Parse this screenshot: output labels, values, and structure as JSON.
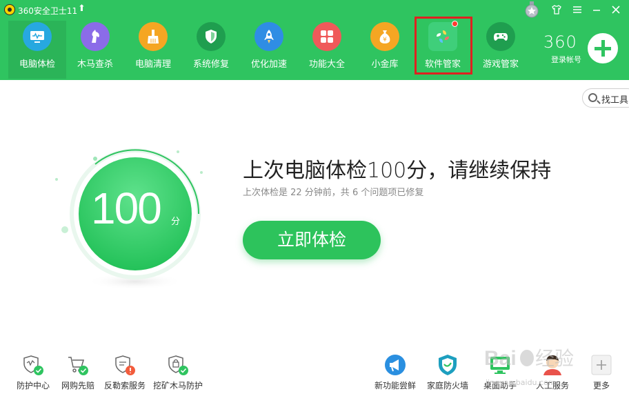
{
  "app": {
    "title": "360安全卫士11",
    "upgrade_glyph": "⬆"
  },
  "window": {
    "skin_icon": "shirt-icon",
    "menu_icon": "menu-icon",
    "minimize_icon": "minimize-icon",
    "close_icon": "close-icon"
  },
  "nav": [
    {
      "label": "电脑体检",
      "icon": "monitor-icon",
      "color": "#27a8e0",
      "active": true
    },
    {
      "label": "木马查杀",
      "icon": "horse-icon",
      "color": "#8b6ce8"
    },
    {
      "label": "电脑清理",
      "icon": "broom-icon",
      "color": "#f5a623"
    },
    {
      "label": "系统修复",
      "icon": "shield-icon",
      "color": "#1f9e4f"
    },
    {
      "label": "优化加速",
      "icon": "rocket-icon",
      "color": "#2f8de4"
    },
    {
      "label": "功能大全",
      "icon": "grid-icon",
      "color": "#ef5a5a"
    },
    {
      "label": "小金库",
      "icon": "money-bag-icon",
      "color": "#f5a623"
    },
    {
      "label": "软件管家",
      "icon": "software-manager-icon",
      "color": "#3fcf7a",
      "badge": true
    },
    {
      "label": "游戏管家",
      "icon": "gamepad-icon",
      "color": "#1f9e4f"
    }
  ],
  "account": {
    "brand": "360",
    "login_label": "登录帐号"
  },
  "tool_search": {
    "label": "找工具"
  },
  "score": {
    "value": "100",
    "unit": "分"
  },
  "main": {
    "headline": "上次电脑体检100分，请继续保持",
    "subline": "上次体检是 22 分钟前，共 6 个问题项已修复",
    "check_button": "立即体检"
  },
  "bottom_left": [
    {
      "label": "防护中心",
      "icon": "shield-check-icon"
    },
    {
      "label": "网购先赔",
      "icon": "cart-check-icon"
    },
    {
      "label": "反勒索服务",
      "icon": "shield-alert-icon"
    },
    {
      "label": "挖矿木马防护",
      "icon": "lock-check-icon"
    }
  ],
  "bottom_right": [
    {
      "label": "新功能尝鲜",
      "icon": "megaphone-icon"
    },
    {
      "label": "家庭防火墙",
      "icon": "firewall-shield-icon"
    },
    {
      "label": "桌面助手",
      "icon": "desktop-icon"
    },
    {
      "label": "人工服务",
      "icon": "agent-icon"
    },
    {
      "label": "更多",
      "icon": "plus-icon"
    }
  ],
  "watermark": {
    "text": "jingyan.baidu.com"
  },
  "colors": {
    "primary": "#2fc460",
    "button": "#2dc35c",
    "highlight_border": "#e02020"
  }
}
